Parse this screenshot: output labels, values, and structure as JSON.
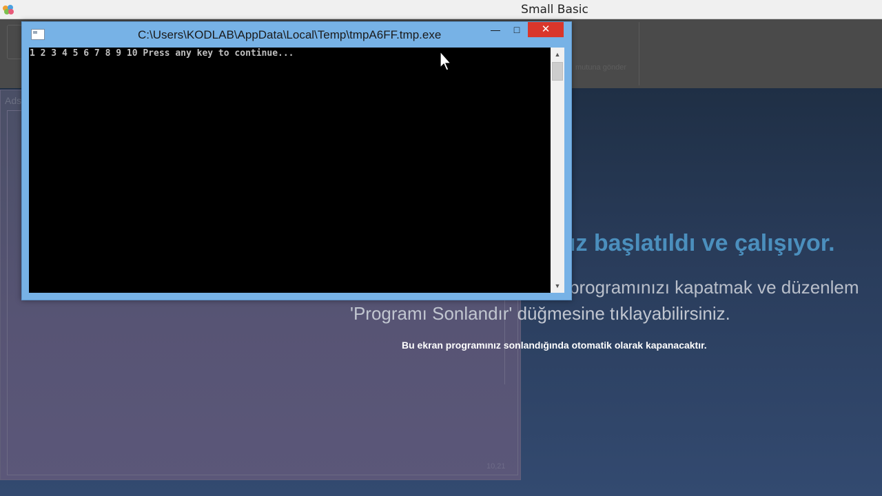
{
  "app": {
    "title": "Small Basic",
    "icon": "small-basic-logo-icon"
  },
  "toolbar": {
    "ghost_label": "mutuna gönder"
  },
  "editor": {
    "tab_label": "Ads",
    "status": "10,21"
  },
  "overlay": {
    "heading": "ız başlatıldı ve çalışıyor.",
    "line1": "programınızı kapatmak ve düzenlem",
    "line2": "'Programı Sonlandır' düğmesine tıklayabilirsiniz.",
    "note": "Bu ekran programınız sonlandığında otomatik olarak kapanacaktır."
  },
  "console": {
    "title": "C:\\Users\\KODLAB\\AppData\\Local\\Temp\\tmpA6FF.tmp.exe",
    "output": "1 2 3 4 5 6 7 8 9 10 Press any key to continue...",
    "minimize_icon": "minimize-icon",
    "maximize_icon": "maximize-icon",
    "close_icon": "close-icon",
    "close_color": "#d9362b",
    "frame_color": "#77b2e6"
  }
}
